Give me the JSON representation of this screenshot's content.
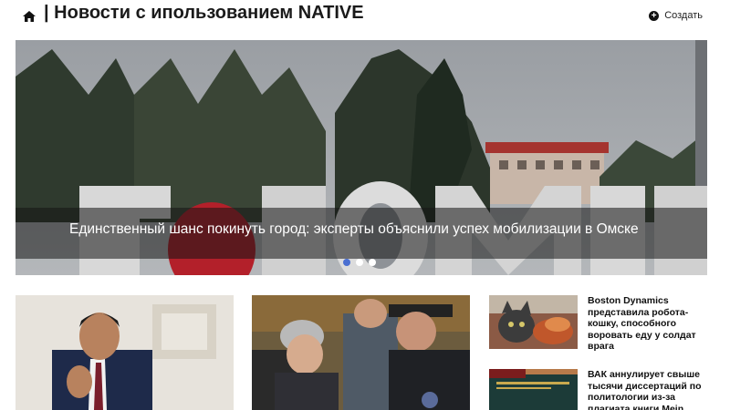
{
  "header": {
    "home_icon": "home-icon",
    "title": "| Новости с ипользованием NATIVE",
    "create_label": "Создать",
    "create_icon": "plus-circle-icon"
  },
  "hero": {
    "headline": "Единственный шанс покинуть город: эксперты объяснили успех мобилизации в Омске",
    "sign_text": "ЯОМСК",
    "dots_total": 3,
    "dots_active": 1
  },
  "news": [
    {
      "title": "",
      "image": "man-in-suit-photo"
    },
    {
      "title": "",
      "image": "police-detaining-woman-photo"
    },
    {
      "title": "Boston Dynamics представила робота-кошку, способного воровать еду у солдат врага",
      "image": "cat-photo"
    },
    {
      "title": "ВАК аннулирует свыше тысячи диссертаций по политологии из-за плагиата книги Mein",
      "image": "books-photo"
    }
  ],
  "colors": {
    "accent_dot": "#4a6fd1",
    "overlay": "#141414"
  }
}
